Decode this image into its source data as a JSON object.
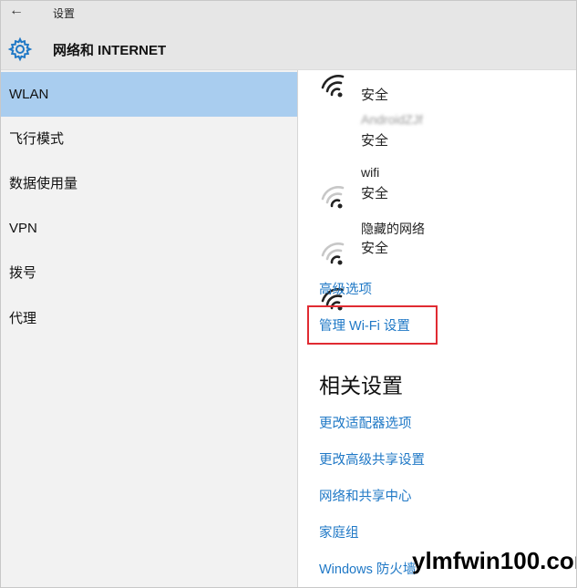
{
  "window": {
    "back_glyph": "←",
    "title": "设置"
  },
  "header": {
    "icon": "gear-icon",
    "title": "网络和 INTERNET"
  },
  "sidebar": {
    "items": [
      {
        "label": "WLAN",
        "selected": true
      },
      {
        "label": "飞行模式",
        "selected": false
      },
      {
        "label": "数据使用量",
        "selected": false
      },
      {
        "label": "VPN",
        "selected": false
      },
      {
        "label": "拨号",
        "selected": false
      },
      {
        "label": "代理",
        "selected": false
      }
    ]
  },
  "networks": [
    {
      "name": "",
      "status": "安全",
      "icon": "wifi-signal-icon"
    },
    {
      "name": "AndroidZJf",
      "status": "安全",
      "icon": "wifi-signal-icon"
    },
    {
      "name": "wifi",
      "status": "安全",
      "icon": "wifi-signal-icon"
    },
    {
      "name": "隐藏的网络",
      "status": "安全",
      "icon": "wifi-signal-icon"
    }
  ],
  "links": {
    "advanced_options": "高级选项",
    "manage_wifi": "管理 Wi-Fi 设置"
  },
  "related": {
    "title": "相关设置",
    "items": [
      "更改适配器选项",
      "更改高级共享设置",
      "网络和共享中心",
      "家庭组",
      "Windows 防火墙"
    ]
  },
  "watermark": "ylmfwin100.com",
  "colors": {
    "accent_link": "#1f78c6",
    "selected_bg": "#a9cdef",
    "highlight_border": "#e02b32"
  }
}
